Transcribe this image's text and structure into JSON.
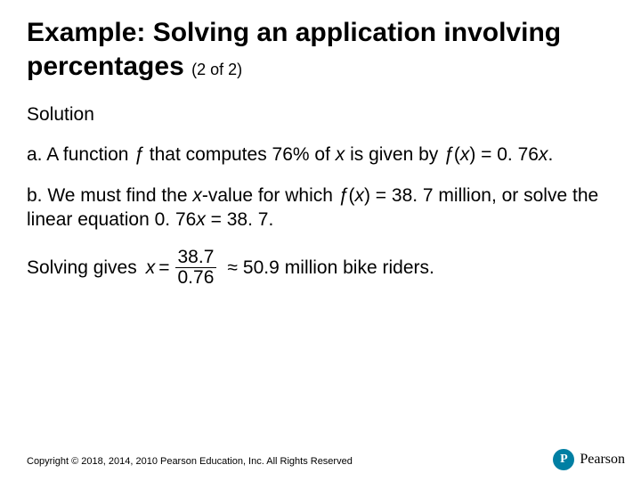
{
  "title": {
    "main": "Example: Solving an application involving percentages",
    "sub": "(2 of 2)"
  },
  "solution_label": "Solution",
  "part_a": {
    "prefix": "a. A function ",
    "f1": "ƒ",
    "mid": " that computes 76% of ",
    "x1": "x",
    "mid2": " is given by ",
    "f2": "ƒ",
    "paren_open": "(",
    "x2": "x",
    "rest": ") = 0. 76",
    "x3": "x",
    "tail": "."
  },
  "part_b": {
    "prefix": "b. We must find the ",
    "x1": "x",
    "mid": "-value for which ",
    "f1": "ƒ",
    "paren_open": "(",
    "x2": "x",
    "mid2": ") = 38. 7 million, or solve the linear equation 0. 76",
    "x3": "x",
    "tail": " = 38. 7."
  },
  "mathline": {
    "pre": "Solving gives",
    "var": "x",
    "eq": "=",
    "num": "38.7",
    "den": "0.76",
    "approx": "≈",
    "result": "50.9",
    "post": "million bike riders."
  },
  "footer": "Copyright © 2018, 2014, 2010 Pearson Education, Inc. All Rights Reserved",
  "logo": {
    "letter": "P",
    "brand": "Pearson"
  }
}
